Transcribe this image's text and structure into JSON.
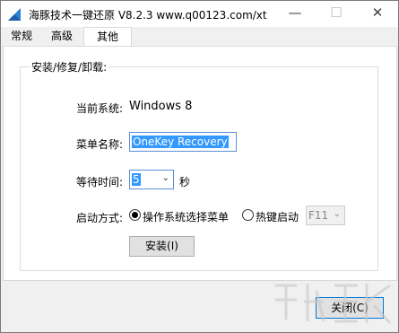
{
  "window": {
    "title": "海豚技术一键还原 V8.2.3 www.q00123.com/xt",
    "minimize_glyph": "—",
    "maximize_glyph": "☐",
    "close_glyph": "✕"
  },
  "tabs": [
    {
      "label": "常规"
    },
    {
      "label": "高级"
    },
    {
      "label": "其他"
    }
  ],
  "group": {
    "title": "安装/修复/卸载:"
  },
  "fields": {
    "system_label": "当前系统:",
    "system_value": "Windows 8",
    "menu_name_label": "菜单名称:",
    "menu_name_value": "OneKey Recovery",
    "wait_label": "等待时间:",
    "wait_value": "5",
    "wait_unit": "秒",
    "boot_label": "启动方式:",
    "boot_option_1": "操作系统选择菜单",
    "boot_option_2": "热键启动",
    "hotkey_value": "F11"
  },
  "buttons": {
    "install": "安装(I)",
    "close": "关闭(C)"
  },
  "icons": {
    "app": "app-icon",
    "chevron": "chevron-down-icon"
  },
  "colors": {
    "selection": "#3399ff",
    "focus_border": "#0078d7"
  }
}
